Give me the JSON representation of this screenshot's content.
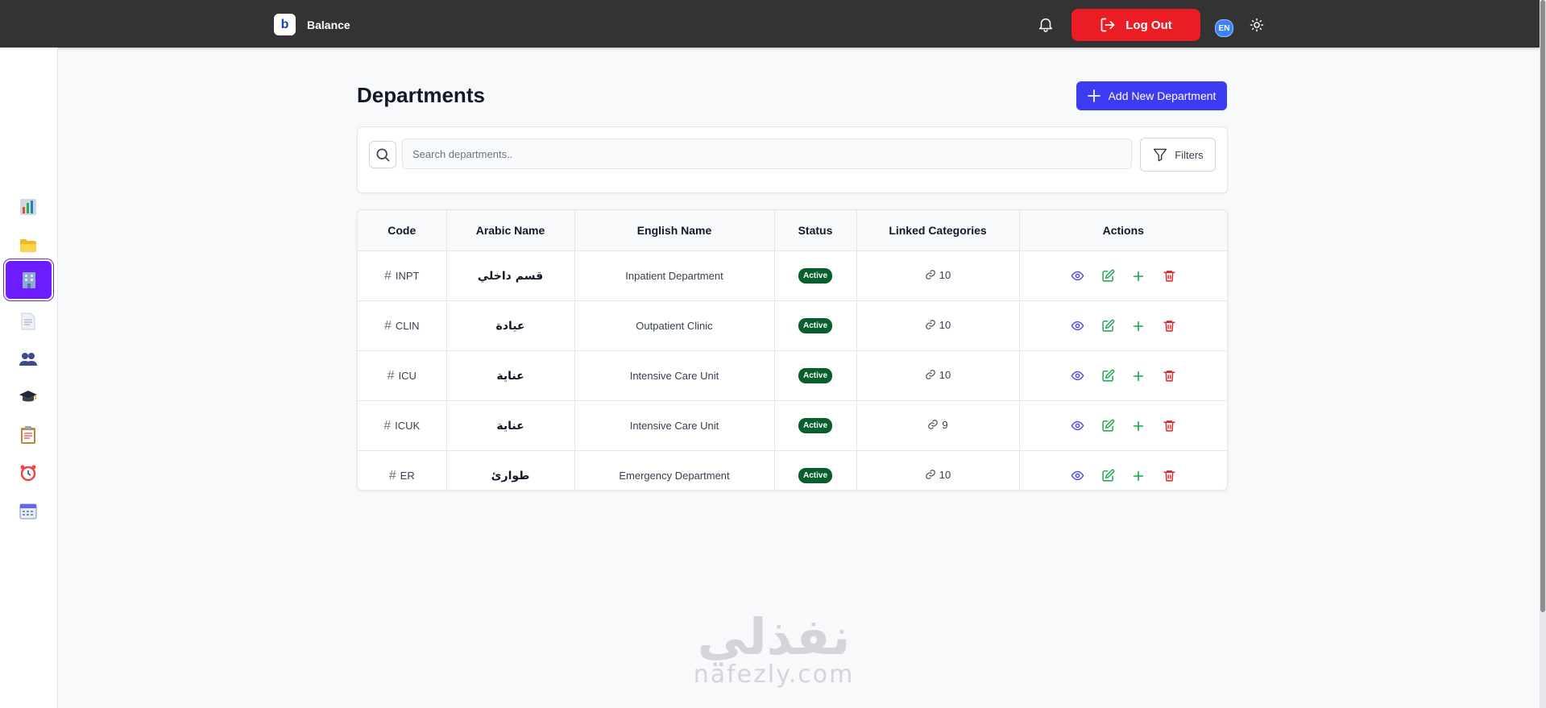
{
  "header": {
    "logo_letter": "b",
    "app_name": "Balance",
    "logout_label": "Log Out",
    "language": "EN"
  },
  "sidebar": {
    "items": [
      {
        "name": "dashboard",
        "icon": "bar-chart-icon"
      },
      {
        "name": "folders",
        "icon": "folder-icon"
      },
      {
        "name": "departments",
        "icon": "building-icon",
        "active": true
      },
      {
        "name": "documents",
        "icon": "document-icon"
      },
      {
        "name": "users",
        "icon": "users-icon"
      },
      {
        "name": "training",
        "icon": "graduation-cap-icon"
      },
      {
        "name": "tasks",
        "icon": "clipboard-icon"
      },
      {
        "name": "alarms",
        "icon": "alarm-clock-icon"
      },
      {
        "name": "calendar",
        "icon": "calendar-icon"
      }
    ]
  },
  "main": {
    "title": "Departments",
    "add_button_label": "Add New Department",
    "search_placeholder": "Search departments..",
    "filters_label": "Filters"
  },
  "table": {
    "columns": [
      "Code",
      "Arabic Name",
      "English Name",
      "Status",
      "Linked Categories",
      "Actions"
    ],
    "rows": [
      {
        "code": "INPT",
        "arabic": "قسم داخلي",
        "english": "Inpatient Department",
        "status": "Active",
        "linked": "10"
      },
      {
        "code": "CLIN",
        "arabic": "عيادة",
        "english": "Outpatient Clinic",
        "status": "Active",
        "linked": "10"
      },
      {
        "code": "ICU",
        "arabic": "عناية",
        "english": "Intensive Care Unit",
        "status": "Active",
        "linked": "10"
      },
      {
        "code": "ICUK",
        "arabic": "عناية",
        "english": "Intensive Care Unit",
        "status": "Active",
        "linked": "9"
      },
      {
        "code": "ER",
        "arabic": "طوارئ",
        "english": "Emergency Department",
        "status": "Active",
        "linked": "10"
      }
    ]
  },
  "watermark": {
    "arabic": "نفذلي",
    "latin": "nafezly.com"
  },
  "colors": {
    "topbar": "#333333",
    "logout": "#ec1c24",
    "primary": "#3b3bf2",
    "active_sidebar": "#6d1bff",
    "status_active": "#065f2c",
    "view": "#4f46e5",
    "edit": "#16a34a",
    "delete": "#dc2626"
  }
}
